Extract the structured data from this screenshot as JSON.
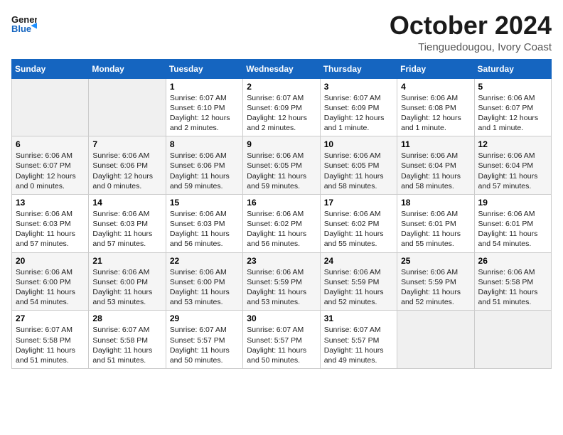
{
  "logo": {
    "line1": "General",
    "line2": "Blue",
    "arrow_color": "#1e90ff"
  },
  "header": {
    "month": "October 2024",
    "location": "Tienguedougou, Ivory Coast"
  },
  "weekdays": [
    "Sunday",
    "Monday",
    "Tuesday",
    "Wednesday",
    "Thursday",
    "Friday",
    "Saturday"
  ],
  "weeks": [
    [
      {
        "day": "",
        "info": ""
      },
      {
        "day": "",
        "info": ""
      },
      {
        "day": "1",
        "info": "Sunrise: 6:07 AM\nSunset: 6:10 PM\nDaylight: 12 hours\nand 2 minutes."
      },
      {
        "day": "2",
        "info": "Sunrise: 6:07 AM\nSunset: 6:09 PM\nDaylight: 12 hours\nand 2 minutes."
      },
      {
        "day": "3",
        "info": "Sunrise: 6:07 AM\nSunset: 6:09 PM\nDaylight: 12 hours\nand 1 minute."
      },
      {
        "day": "4",
        "info": "Sunrise: 6:06 AM\nSunset: 6:08 PM\nDaylight: 12 hours\nand 1 minute."
      },
      {
        "day": "5",
        "info": "Sunrise: 6:06 AM\nSunset: 6:07 PM\nDaylight: 12 hours\nand 1 minute."
      }
    ],
    [
      {
        "day": "6",
        "info": "Sunrise: 6:06 AM\nSunset: 6:07 PM\nDaylight: 12 hours\nand 0 minutes."
      },
      {
        "day": "7",
        "info": "Sunrise: 6:06 AM\nSunset: 6:06 PM\nDaylight: 12 hours\nand 0 minutes."
      },
      {
        "day": "8",
        "info": "Sunrise: 6:06 AM\nSunset: 6:06 PM\nDaylight: 11 hours\nand 59 minutes."
      },
      {
        "day": "9",
        "info": "Sunrise: 6:06 AM\nSunset: 6:05 PM\nDaylight: 11 hours\nand 59 minutes."
      },
      {
        "day": "10",
        "info": "Sunrise: 6:06 AM\nSunset: 6:05 PM\nDaylight: 11 hours\nand 58 minutes."
      },
      {
        "day": "11",
        "info": "Sunrise: 6:06 AM\nSunset: 6:04 PM\nDaylight: 11 hours\nand 58 minutes."
      },
      {
        "day": "12",
        "info": "Sunrise: 6:06 AM\nSunset: 6:04 PM\nDaylight: 11 hours\nand 57 minutes."
      }
    ],
    [
      {
        "day": "13",
        "info": "Sunrise: 6:06 AM\nSunset: 6:03 PM\nDaylight: 11 hours\nand 57 minutes."
      },
      {
        "day": "14",
        "info": "Sunrise: 6:06 AM\nSunset: 6:03 PM\nDaylight: 11 hours\nand 57 minutes."
      },
      {
        "day": "15",
        "info": "Sunrise: 6:06 AM\nSunset: 6:03 PM\nDaylight: 11 hours\nand 56 minutes."
      },
      {
        "day": "16",
        "info": "Sunrise: 6:06 AM\nSunset: 6:02 PM\nDaylight: 11 hours\nand 56 minutes."
      },
      {
        "day": "17",
        "info": "Sunrise: 6:06 AM\nSunset: 6:02 PM\nDaylight: 11 hours\nand 55 minutes."
      },
      {
        "day": "18",
        "info": "Sunrise: 6:06 AM\nSunset: 6:01 PM\nDaylight: 11 hours\nand 55 minutes."
      },
      {
        "day": "19",
        "info": "Sunrise: 6:06 AM\nSunset: 6:01 PM\nDaylight: 11 hours\nand 54 minutes."
      }
    ],
    [
      {
        "day": "20",
        "info": "Sunrise: 6:06 AM\nSunset: 6:00 PM\nDaylight: 11 hours\nand 54 minutes."
      },
      {
        "day": "21",
        "info": "Sunrise: 6:06 AM\nSunset: 6:00 PM\nDaylight: 11 hours\nand 53 minutes."
      },
      {
        "day": "22",
        "info": "Sunrise: 6:06 AM\nSunset: 6:00 PM\nDaylight: 11 hours\nand 53 minutes."
      },
      {
        "day": "23",
        "info": "Sunrise: 6:06 AM\nSunset: 5:59 PM\nDaylight: 11 hours\nand 53 minutes."
      },
      {
        "day": "24",
        "info": "Sunrise: 6:06 AM\nSunset: 5:59 PM\nDaylight: 11 hours\nand 52 minutes."
      },
      {
        "day": "25",
        "info": "Sunrise: 6:06 AM\nSunset: 5:59 PM\nDaylight: 11 hours\nand 52 minutes."
      },
      {
        "day": "26",
        "info": "Sunrise: 6:06 AM\nSunset: 5:58 PM\nDaylight: 11 hours\nand 51 minutes."
      }
    ],
    [
      {
        "day": "27",
        "info": "Sunrise: 6:07 AM\nSunset: 5:58 PM\nDaylight: 11 hours\nand 51 minutes."
      },
      {
        "day": "28",
        "info": "Sunrise: 6:07 AM\nSunset: 5:58 PM\nDaylight: 11 hours\nand 51 minutes."
      },
      {
        "day": "29",
        "info": "Sunrise: 6:07 AM\nSunset: 5:57 PM\nDaylight: 11 hours\nand 50 minutes."
      },
      {
        "day": "30",
        "info": "Sunrise: 6:07 AM\nSunset: 5:57 PM\nDaylight: 11 hours\nand 50 minutes."
      },
      {
        "day": "31",
        "info": "Sunrise: 6:07 AM\nSunset: 5:57 PM\nDaylight: 11 hours\nand 49 minutes."
      },
      {
        "day": "",
        "info": ""
      },
      {
        "day": "",
        "info": ""
      }
    ]
  ]
}
